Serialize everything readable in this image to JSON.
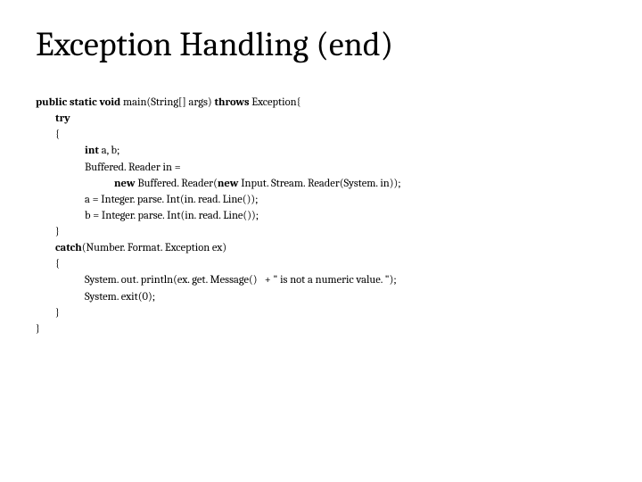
{
  "title": "Exception Handling (end)",
  "code": {
    "l1a": "public static void ",
    "l1b": "main(String[] args) ",
    "l1c": "throws ",
    "l1d": "Exception{",
    "l2": "        try",
    "l3": "        {",
    "l4a": "                    int ",
    "l4b": "a, b;",
    "l5": "                    Buffered. Reader in =",
    "l6a": "                                new ",
    "l6b": "Buffered. Reader(",
    "l6c": "new ",
    "l6d": "Input. Stream. Reader(System. in));",
    "l7": "                    a = Integer. parse. Int(in. read. Line());",
    "l8": "                    b = Integer. parse. Int(in. read. Line());",
    "l9": "        }",
    "l10a": "        catch",
    "l10b": "(Number. Format. Exception ex)",
    "l11": "        {",
    "l12": "                    System. out. println(ex. get. Message()   + \" is not a numeric value. \");",
    "l13": "                    System. exit(0);",
    "l14": "        }",
    "l15": "}"
  }
}
